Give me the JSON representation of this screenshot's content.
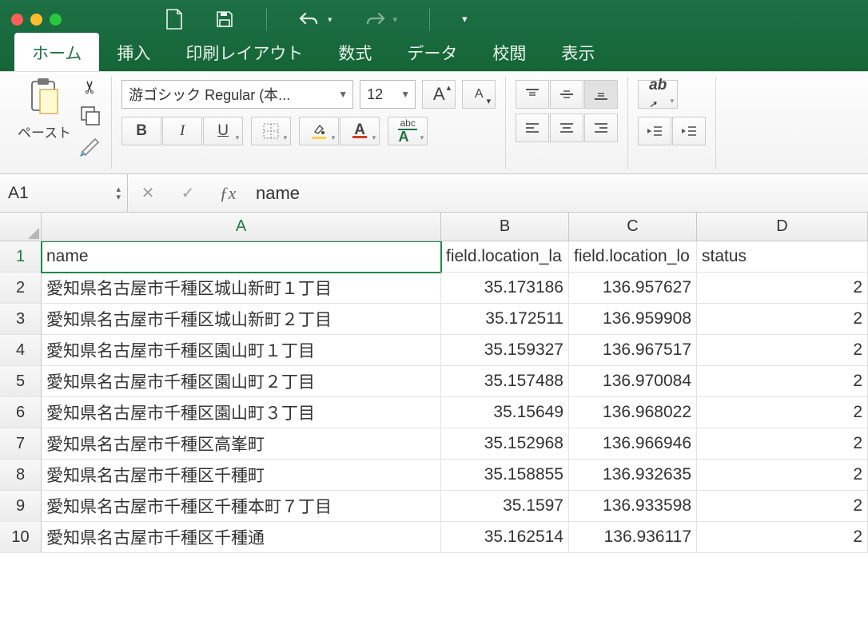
{
  "tabs": [
    "ホーム",
    "挿入",
    "印刷レイアウト",
    "数式",
    "データ",
    "校閲",
    "表示"
  ],
  "active_tab": "ホーム",
  "paste_label": "ペースト",
  "font_name": "游ゴシック Regular (本...",
  "font_size": "12",
  "name_box": "A1",
  "formula_value": "name",
  "columns": [
    "A",
    "B",
    "C",
    "D"
  ],
  "col_widths": {
    "A": 500,
    "B": 160,
    "C": 160,
    "D": 214
  },
  "headers": [
    "name",
    "field.location_la",
    "field.location_lo",
    "status"
  ],
  "rows": [
    {
      "n": 2,
      "a": "愛知県名古屋市千種区城山新町１丁目",
      "b": "35.173186",
      "c": "136.957627",
      "d": "2"
    },
    {
      "n": 3,
      "a": "愛知県名古屋市千種区城山新町２丁目",
      "b": "35.172511",
      "c": "136.959908",
      "d": "2"
    },
    {
      "n": 4,
      "a": "愛知県名古屋市千種区園山町１丁目",
      "b": "35.159327",
      "c": "136.967517",
      "d": "2"
    },
    {
      "n": 5,
      "a": "愛知県名古屋市千種区園山町２丁目",
      "b": "35.157488",
      "c": "136.970084",
      "d": "2"
    },
    {
      "n": 6,
      "a": "愛知県名古屋市千種区園山町３丁目",
      "b": "35.15649",
      "c": "136.968022",
      "d": "2"
    },
    {
      "n": 7,
      "a": "愛知県名古屋市千種区高峯町",
      "b": "35.152968",
      "c": "136.966946",
      "d": "2"
    },
    {
      "n": 8,
      "a": "愛知県名古屋市千種区千種町",
      "b": "35.158855",
      "c": "136.932635",
      "d": "2"
    },
    {
      "n": 9,
      "a": "愛知県名古屋市千種区千種本町７丁目",
      "b": "35.1597",
      "c": "136.933598",
      "d": "2"
    },
    {
      "n": 10,
      "a": "愛知県名古屋市千種区千種通",
      "b": "35.162514",
      "c": "136.936117",
      "d": "2"
    }
  ]
}
